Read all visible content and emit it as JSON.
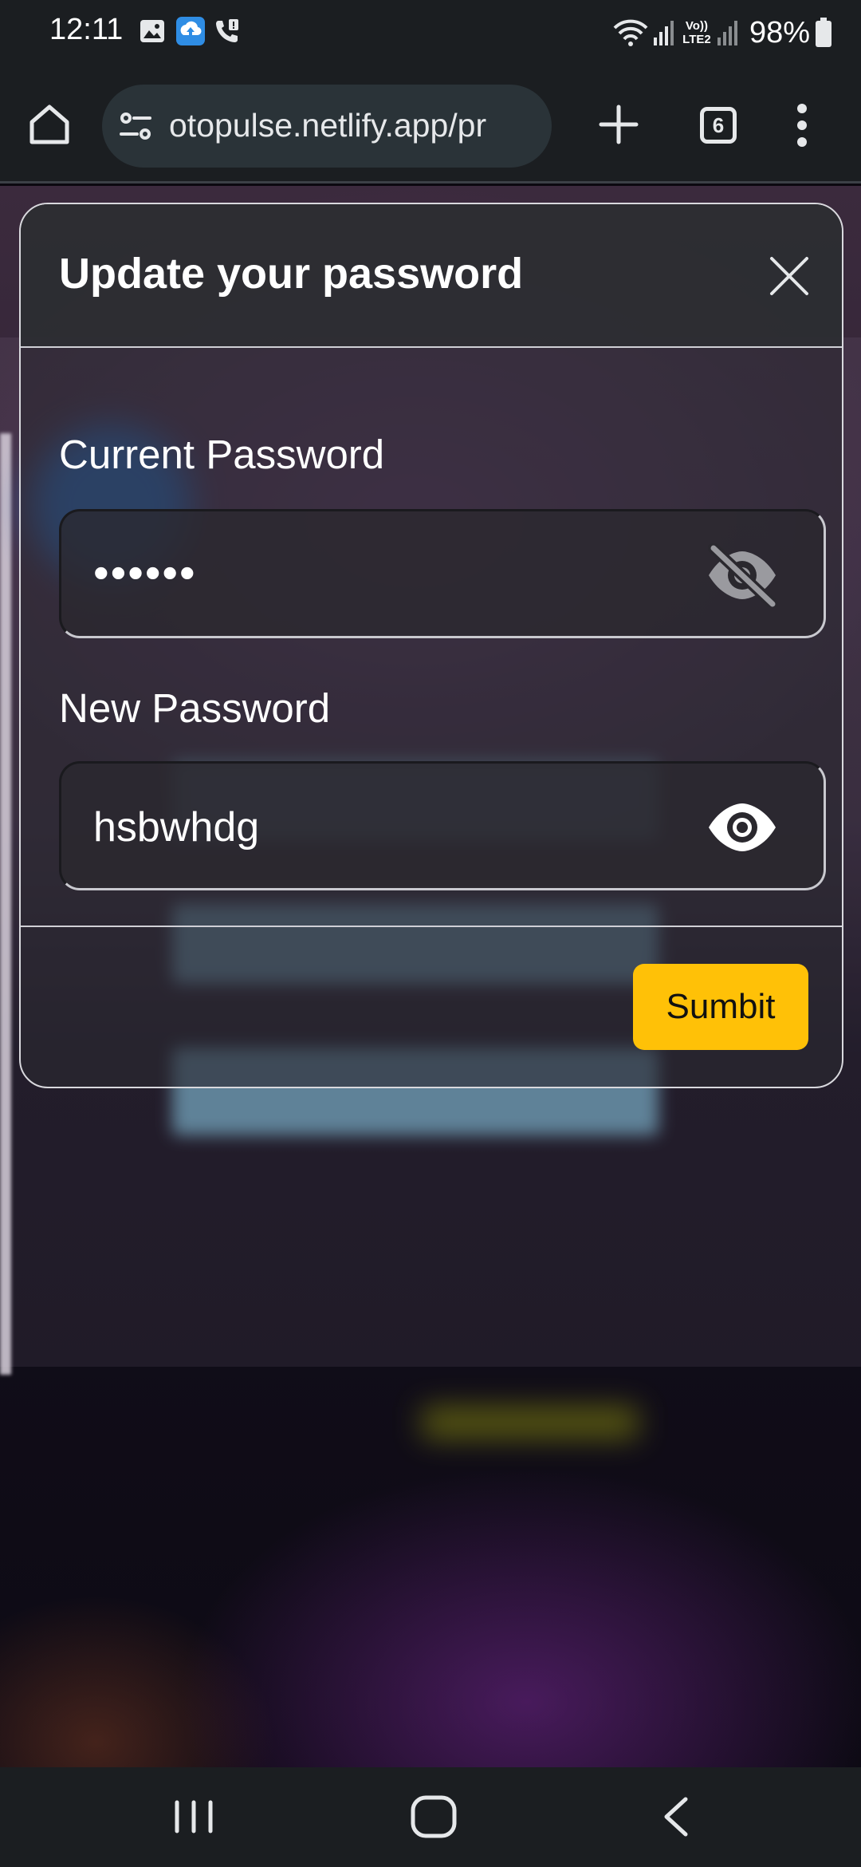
{
  "status_bar": {
    "time": "12:11",
    "network_label": "Vo)) LTE2",
    "battery": "98%"
  },
  "browser": {
    "url": "otopulse.netlify.app/pr",
    "tab_count": "6"
  },
  "modal": {
    "title": "Update your password",
    "current_password": {
      "label": "Current Password",
      "value": "••••••",
      "visibility": "hidden"
    },
    "new_password": {
      "label": "New Password",
      "value": "hsbwhdg",
      "visibility": "visible"
    },
    "submit_label": "Sumbit"
  },
  "colors": {
    "accent": "#ffc107",
    "chrome": "#1b1e21",
    "url_bar": "#2a3338"
  },
  "icons": {
    "toolbar": [
      "home-icon",
      "site-info-icon",
      "plus-icon",
      "tab-switcher-icon",
      "more-vert-icon"
    ],
    "modal": [
      "close-icon",
      "eye-off-icon",
      "eye-icon"
    ],
    "nav": [
      "recents-icon",
      "home-nav-icon",
      "back-icon"
    ]
  }
}
